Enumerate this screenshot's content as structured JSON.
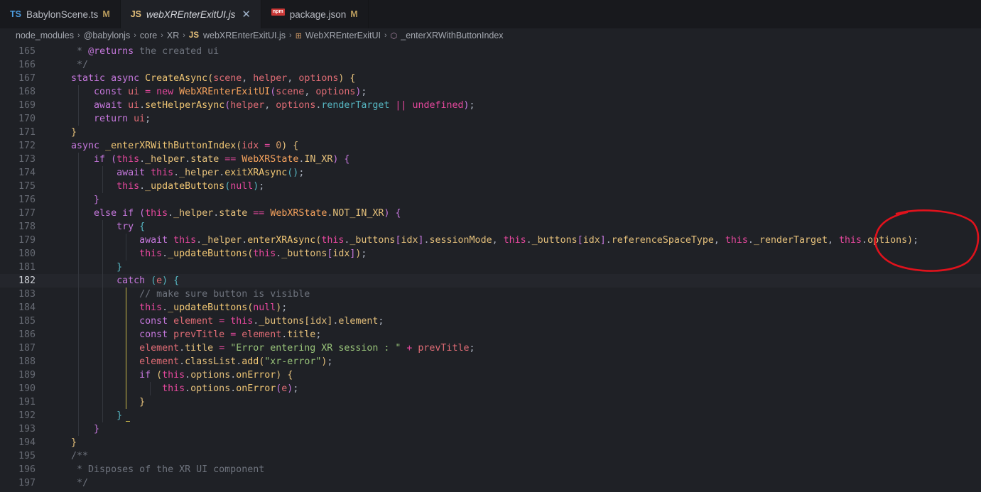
{
  "tabs": [
    {
      "icon": "TS",
      "label": "BabylonScene.ts",
      "status": "M",
      "active": false
    },
    {
      "icon": "JS",
      "label": "webXREnterExitUI.js",
      "close": "✕",
      "active": true
    },
    {
      "icon": "npm",
      "label": "package.json",
      "status": "M",
      "active": false
    }
  ],
  "breadcrumb": {
    "items": [
      "node_modules",
      "@babylonjs",
      "core",
      "XR",
      "webXREnterExitUI.js",
      "WebXREnterExitUI",
      "_enterXRWithButtonIndex"
    ],
    "js_icon": "JS",
    "sep": "›"
  },
  "editor": {
    "current_line": 182,
    "lines": [
      {
        "n": 165,
        "tokens": [
          [
            "   ",
            ""
          ],
          [
            " * ",
            "cm"
          ],
          [
            "@returns",
            "cmtag"
          ],
          [
            " the created ui",
            "cm"
          ]
        ]
      },
      {
        "n": 166,
        "tokens": [
          [
            "    */",
            "cm"
          ]
        ]
      },
      {
        "n": 167,
        "tokens": [
          [
            "   ",
            ""
          ],
          [
            "static ",
            "kw"
          ],
          [
            "async ",
            "kw"
          ],
          [
            "CreateAsync",
            "fn"
          ],
          [
            "(",
            "br1"
          ],
          [
            "scene",
            "prm"
          ],
          [
            ", ",
            "pu"
          ],
          [
            "helper",
            "prm"
          ],
          [
            ", ",
            "pu"
          ],
          [
            "options",
            "prm"
          ],
          [
            ") ",
            "br1"
          ],
          [
            "{",
            "br1"
          ]
        ]
      },
      {
        "n": 168,
        "tokens": [
          [
            "       ",
            ""
          ],
          [
            "const ",
            "kw"
          ],
          [
            "ui ",
            "var"
          ],
          [
            "= ",
            "op"
          ],
          [
            "new ",
            "kw2"
          ],
          [
            "WebXREnterExitUI",
            "cls"
          ],
          [
            "(",
            "br2"
          ],
          [
            "scene",
            "prm"
          ],
          [
            ", ",
            "pu"
          ],
          [
            "options",
            "prm"
          ],
          [
            ")",
            "br2"
          ],
          [
            ";",
            "pu"
          ]
        ]
      },
      {
        "n": 169,
        "tokens": [
          [
            "       ",
            ""
          ],
          [
            "await ",
            "kw"
          ],
          [
            "ui",
            "var"
          ],
          [
            ".",
            "pu"
          ],
          [
            "setHelperAsync",
            "fn"
          ],
          [
            "(",
            "br2"
          ],
          [
            "helper",
            "prm"
          ],
          [
            ", ",
            "pu"
          ],
          [
            "options",
            "prm"
          ],
          [
            ".",
            "pu"
          ],
          [
            "renderTarget ",
            "pr"
          ],
          [
            "|| ",
            "op"
          ],
          [
            "undefined",
            "kw2"
          ],
          [
            ")",
            "br2"
          ],
          [
            ";",
            "pu"
          ]
        ]
      },
      {
        "n": 170,
        "tokens": [
          [
            "       ",
            ""
          ],
          [
            "return ",
            "kw"
          ],
          [
            "ui",
            "var"
          ],
          [
            ";",
            "pu"
          ]
        ]
      },
      {
        "n": 171,
        "tokens": [
          [
            "   ",
            ""
          ],
          [
            "}",
            "br1"
          ]
        ]
      },
      {
        "n": 172,
        "tokens": [
          [
            "   ",
            ""
          ],
          [
            "async ",
            "kw"
          ],
          [
            "_enterXRWithButtonIndex",
            "fn"
          ],
          [
            "(",
            "br1"
          ],
          [
            "idx ",
            "prm"
          ],
          [
            "= ",
            "op"
          ],
          [
            "0",
            "num"
          ],
          [
            ") ",
            "br1"
          ],
          [
            "{",
            "br1"
          ]
        ]
      },
      {
        "n": 173,
        "tokens": [
          [
            "       ",
            ""
          ],
          [
            "if ",
            "kw"
          ],
          [
            "(",
            "br2"
          ],
          [
            "this",
            "th"
          ],
          [
            ".",
            "pu"
          ],
          [
            "_helper",
            "id"
          ],
          [
            ".",
            "pu"
          ],
          [
            "state ",
            "id"
          ],
          [
            "== ",
            "op"
          ],
          [
            "WebXRState",
            "cls"
          ],
          [
            ".",
            "pu"
          ],
          [
            "IN_XR",
            "id"
          ],
          [
            ") ",
            "br2"
          ],
          [
            "{",
            "br2"
          ]
        ]
      },
      {
        "n": 174,
        "tokens": [
          [
            "           ",
            ""
          ],
          [
            "await ",
            "kw"
          ],
          [
            "this",
            "th"
          ],
          [
            ".",
            "pu"
          ],
          [
            "_helper",
            "id"
          ],
          [
            ".",
            "pu"
          ],
          [
            "exitXRAsync",
            "fn"
          ],
          [
            "(",
            "br3"
          ],
          [
            ")",
            "br3"
          ],
          [
            ";",
            "pu"
          ]
        ]
      },
      {
        "n": 175,
        "tokens": [
          [
            "           ",
            ""
          ],
          [
            "this",
            "th"
          ],
          [
            ".",
            "pu"
          ],
          [
            "_updateButtons",
            "fn"
          ],
          [
            "(",
            "br3"
          ],
          [
            "null",
            "kw2"
          ],
          [
            ")",
            "br3"
          ],
          [
            ";",
            "pu"
          ]
        ]
      },
      {
        "n": 176,
        "tokens": [
          [
            "       ",
            ""
          ],
          [
            "}",
            "br2"
          ]
        ]
      },
      {
        "n": 177,
        "tokens": [
          [
            "       ",
            ""
          ],
          [
            "else ",
            "kw"
          ],
          [
            "if ",
            "kw"
          ],
          [
            "(",
            "br2"
          ],
          [
            "this",
            "th"
          ],
          [
            ".",
            "pu"
          ],
          [
            "_helper",
            "id"
          ],
          [
            ".",
            "pu"
          ],
          [
            "state ",
            "id"
          ],
          [
            "== ",
            "op"
          ],
          [
            "WebXRState",
            "cls"
          ],
          [
            ".",
            "pu"
          ],
          [
            "NOT_IN_XR",
            "id"
          ],
          [
            ") ",
            "br2"
          ],
          [
            "{",
            "br2"
          ]
        ]
      },
      {
        "n": 178,
        "tokens": [
          [
            "           ",
            ""
          ],
          [
            "try ",
            "kw"
          ],
          [
            "{",
            "br3"
          ]
        ]
      },
      {
        "n": 179,
        "tokens": [
          [
            "               ",
            ""
          ],
          [
            "await ",
            "kw"
          ],
          [
            "this",
            "th"
          ],
          [
            ".",
            "pu"
          ],
          [
            "_helper",
            "id"
          ],
          [
            ".",
            "pu"
          ],
          [
            "enterXRAsync",
            "fn"
          ],
          [
            "(",
            "br1"
          ],
          [
            "this",
            "th"
          ],
          [
            ".",
            "pu"
          ],
          [
            "_buttons",
            "id"
          ],
          [
            "[",
            "br2"
          ],
          [
            "idx",
            "id"
          ],
          [
            "]",
            "br2"
          ],
          [
            ".",
            "pu"
          ],
          [
            "sessionMode",
            "id"
          ],
          [
            ", ",
            "pu"
          ],
          [
            "this",
            "th"
          ],
          [
            ".",
            "pu"
          ],
          [
            "_buttons",
            "id"
          ],
          [
            "[",
            "br2"
          ],
          [
            "idx",
            "id"
          ],
          [
            "]",
            "br2"
          ],
          [
            ".",
            "pu"
          ],
          [
            "referenceSpaceType",
            "id"
          ],
          [
            ", ",
            "pu"
          ],
          [
            "this",
            "th"
          ],
          [
            ".",
            "pu"
          ],
          [
            "_renderTarget",
            "id"
          ],
          [
            ", ",
            "pu"
          ],
          [
            "this",
            "th"
          ],
          [
            ".",
            "pu"
          ],
          [
            "options",
            "id"
          ],
          [
            ")",
            "br1"
          ],
          [
            ";",
            "pu"
          ]
        ]
      },
      {
        "n": 180,
        "tokens": [
          [
            "               ",
            ""
          ],
          [
            "this",
            "th"
          ],
          [
            ".",
            "pu"
          ],
          [
            "_updateButtons",
            "fn"
          ],
          [
            "(",
            "br1"
          ],
          [
            "this",
            "th"
          ],
          [
            ".",
            "pu"
          ],
          [
            "_buttons",
            "id"
          ],
          [
            "[",
            "br2"
          ],
          [
            "idx",
            "id"
          ],
          [
            "]",
            "br2"
          ],
          [
            ")",
            "br1"
          ],
          [
            ";",
            "pu"
          ]
        ]
      },
      {
        "n": 181,
        "tokens": [
          [
            "           ",
            ""
          ],
          [
            "}",
            "br3"
          ]
        ]
      },
      {
        "n": 182,
        "tokens": [
          [
            "           ",
            ""
          ],
          [
            "catch ",
            "kw"
          ],
          [
            "(",
            "br3"
          ],
          [
            "e",
            "prm"
          ],
          [
            ") ",
            "br3"
          ],
          [
            "{",
            "br3"
          ]
        ]
      },
      {
        "n": 183,
        "tokens": [
          [
            "               ",
            ""
          ],
          [
            "// make sure button is visible",
            "cm"
          ]
        ]
      },
      {
        "n": 184,
        "tokens": [
          [
            "               ",
            ""
          ],
          [
            "this",
            "th"
          ],
          [
            ".",
            "pu"
          ],
          [
            "_updateButtons",
            "fn"
          ],
          [
            "(",
            "br1"
          ],
          [
            "null",
            "kw2"
          ],
          [
            ")",
            "br1"
          ],
          [
            ";",
            "pu"
          ]
        ]
      },
      {
        "n": 185,
        "tokens": [
          [
            "               ",
            ""
          ],
          [
            "const ",
            "kw"
          ],
          [
            "element ",
            "var"
          ],
          [
            "= ",
            "op"
          ],
          [
            "this",
            "th"
          ],
          [
            ".",
            "pu"
          ],
          [
            "_buttons",
            "id"
          ],
          [
            "[",
            "br1"
          ],
          [
            "idx",
            "id"
          ],
          [
            "]",
            "br1"
          ],
          [
            ".",
            "pu"
          ],
          [
            "element",
            "id"
          ],
          [
            ";",
            "pu"
          ]
        ]
      },
      {
        "n": 186,
        "tokens": [
          [
            "               ",
            ""
          ],
          [
            "const ",
            "kw"
          ],
          [
            "prevTitle ",
            "var"
          ],
          [
            "= ",
            "op"
          ],
          [
            "element",
            "var"
          ],
          [
            ".",
            "pu"
          ],
          [
            "title",
            "id"
          ],
          [
            ";",
            "pu"
          ]
        ]
      },
      {
        "n": 187,
        "tokens": [
          [
            "               ",
            ""
          ],
          [
            "element",
            "var"
          ],
          [
            ".",
            "pu"
          ],
          [
            "title ",
            "id"
          ],
          [
            "= ",
            "op"
          ],
          [
            "\"Error entering XR session : \" ",
            "str"
          ],
          [
            "+ ",
            "op"
          ],
          [
            "prevTitle",
            "var"
          ],
          [
            ";",
            "pu"
          ]
        ]
      },
      {
        "n": 188,
        "tokens": [
          [
            "               ",
            ""
          ],
          [
            "element",
            "var"
          ],
          [
            ".",
            "pu"
          ],
          [
            "classList",
            "id"
          ],
          [
            ".",
            "pu"
          ],
          [
            "add",
            "fn"
          ],
          [
            "(",
            "br1"
          ],
          [
            "\"xr-error\"",
            "str"
          ],
          [
            ")",
            "br1"
          ],
          [
            ";",
            "pu"
          ]
        ]
      },
      {
        "n": 189,
        "tokens": [
          [
            "               ",
            ""
          ],
          [
            "if ",
            "kw"
          ],
          [
            "(",
            "br1"
          ],
          [
            "this",
            "th"
          ],
          [
            ".",
            "pu"
          ],
          [
            "options",
            "id"
          ],
          [
            ".",
            "pu"
          ],
          [
            "onError",
            "fn"
          ],
          [
            ") ",
            "br1"
          ],
          [
            "{",
            "br1"
          ]
        ]
      },
      {
        "n": 190,
        "tokens": [
          [
            "                   ",
            ""
          ],
          [
            "this",
            "th"
          ],
          [
            ".",
            "pu"
          ],
          [
            "options",
            "id"
          ],
          [
            ".",
            "pu"
          ],
          [
            "onError",
            "fn"
          ],
          [
            "(",
            "br2"
          ],
          [
            "e",
            "prm"
          ],
          [
            ")",
            "br2"
          ],
          [
            ";",
            "pu"
          ]
        ]
      },
      {
        "n": 191,
        "tokens": [
          [
            "               ",
            ""
          ],
          [
            "}",
            "br1"
          ]
        ]
      },
      {
        "n": 192,
        "tokens": [
          [
            "           ",
            ""
          ],
          [
            "}",
            "br3"
          ]
        ]
      },
      {
        "n": 193,
        "tokens": [
          [
            "       ",
            ""
          ],
          [
            "}",
            "br2"
          ]
        ]
      },
      {
        "n": 194,
        "tokens": [
          [
            "   ",
            ""
          ],
          [
            "}",
            "br1"
          ]
        ]
      },
      {
        "n": 195,
        "tokens": [
          [
            "   ",
            ""
          ],
          [
            "/**",
            "cm"
          ]
        ]
      },
      {
        "n": 196,
        "tokens": [
          [
            "    ",
            ""
          ],
          [
            "* Disposes of the XR UI component",
            "cm"
          ]
        ]
      },
      {
        "n": 197,
        "tokens": [
          [
            "    ",
            ""
          ],
          [
            "*/",
            "cm"
          ]
        ]
      }
    ]
  },
  "colors": {
    "annotation": "#e0121c",
    "background": "#1f2126"
  }
}
